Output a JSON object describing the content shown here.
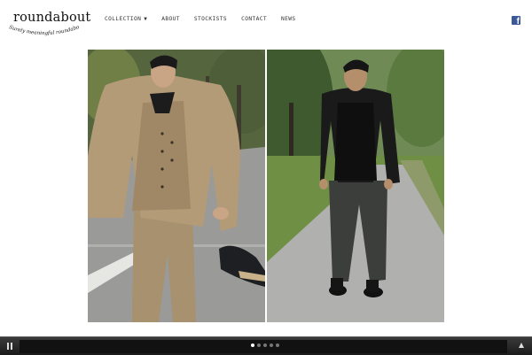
{
  "brand": {
    "name": "roundabout",
    "tagline": "Surely meaningful roundabout"
  },
  "nav": {
    "items": [
      {
        "label": "COLLECTION",
        "has_dropdown": true
      },
      {
        "label": "ABOUT"
      },
      {
        "label": "STOCKISTS"
      },
      {
        "label": "CONTACT"
      },
      {
        "label": "NEWS"
      }
    ]
  },
  "social": {
    "facebook_glyph": "f",
    "icon": "facebook-icon",
    "color": "#3b5998"
  },
  "gallery": {
    "photos": [
      {
        "subject": "model in beige wool coat, vest and trousers"
      },
      {
        "subject": "model in black hooded jacket and grey trousers"
      }
    ]
  },
  "slideshow": {
    "slide_count": 5,
    "active_index": 0,
    "pause_icon": "pause-icon",
    "toggle_icon": "chevron-up-icon"
  }
}
